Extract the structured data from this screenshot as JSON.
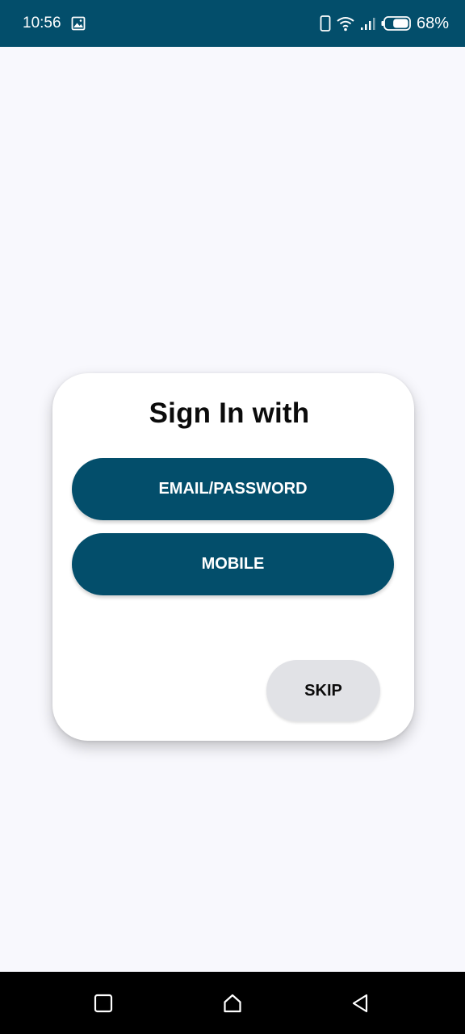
{
  "status_bar": {
    "time": "10:56",
    "battery_percent": "68%",
    "icons": [
      "gallery-notification-icon",
      "vibrate-icon",
      "wifi-icon",
      "signal-icon",
      "battery-icon"
    ],
    "battery_level": 0.68
  },
  "dialog": {
    "title": "Sign In with",
    "email_button_label": "EMAIL/PASSWORD",
    "mobile_button_label": "MOBILE",
    "skip_button_label": "SKIP"
  },
  "nav_bar": {
    "icons": [
      "recents-icon",
      "home-icon",
      "back-icon"
    ]
  },
  "colors": {
    "status_bar_bg": "#034e6b",
    "primary_button_bg": "#034e6b",
    "skip_button_bg": "#e1e2e6",
    "screen_bg": "#f8f8fd",
    "dialog_bg": "#ffffff",
    "nav_bar_bg": "#000000"
  }
}
